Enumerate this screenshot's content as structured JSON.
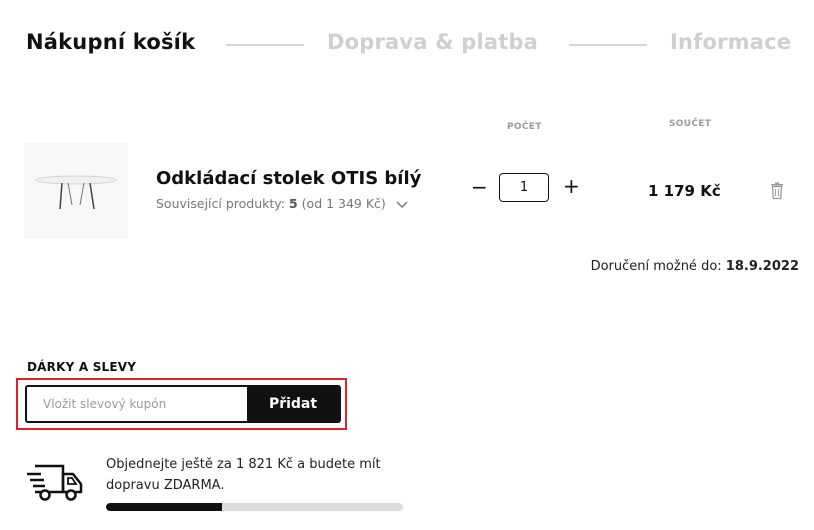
{
  "steps": [
    {
      "label": "Nákupní košík",
      "active": true
    },
    {
      "label": "Doprava & platba",
      "active": false
    },
    {
      "label": "Informace",
      "active": false
    }
  ],
  "columns": {
    "qty": "POČET",
    "total": "SOUČET"
  },
  "product": {
    "name": "Odkládací stolek OTIS bílý",
    "related_prefix": "Související produkty:",
    "related_count": "5",
    "related_from": "(od 1 349 Kč)",
    "minus": "−",
    "quantity": "1",
    "plus": "+",
    "price": "1 179 Kč"
  },
  "delivery": {
    "label": "Doručení možné do:",
    "date": "18.9.2022"
  },
  "coupon": {
    "title": "DÁRKY A SLEVY",
    "placeholder": "Vložit slevový kupón",
    "value": "",
    "button": "Přidat"
  },
  "shipping": {
    "text_before": "Objednejte ještě za",
    "amount": "1 821 Kč",
    "text_after": "a budete mít dopravu ZDARMA.",
    "progress": 0.39
  }
}
